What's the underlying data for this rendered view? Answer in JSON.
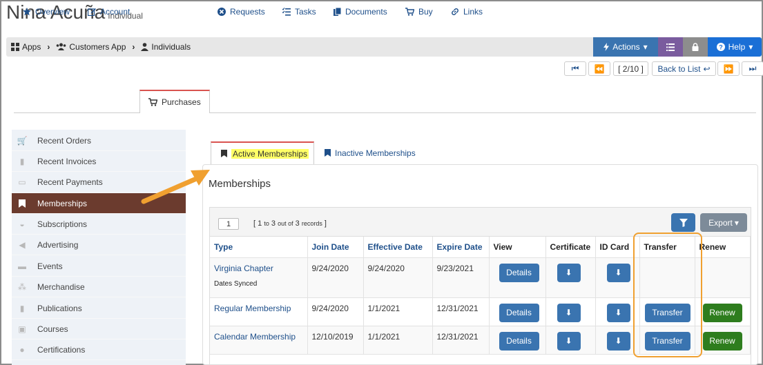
{
  "header": {
    "name": "Nina Acuña",
    "type": "Individual"
  },
  "breadcrumb": [
    {
      "label": "Apps",
      "icon": "grid-icon"
    },
    {
      "label": "Customers App",
      "icon": "users-icon"
    },
    {
      "label": "Individuals",
      "icon": "user-icon"
    }
  ],
  "toolbar": {
    "actions_label": "Actions",
    "help_label": "Help"
  },
  "pager": {
    "position": "[ 2/10 ]",
    "back_label": "Back to List"
  },
  "main_tabs": [
    {
      "label": "Overview",
      "icon": "star-icon"
    },
    {
      "label": "Account",
      "icon": "edit-icon"
    },
    {
      "label": "Purchases",
      "icon": "cart-icon",
      "active": true
    },
    {
      "label": "Requests",
      "icon": "circle-x-icon"
    },
    {
      "label": "Tasks",
      "icon": "tasks-icon"
    },
    {
      "label": "Documents",
      "icon": "documents-icon"
    },
    {
      "label": "Buy",
      "icon": "cart-icon"
    },
    {
      "label": "Links",
      "icon": "link-icon"
    }
  ],
  "sidebar": {
    "items": [
      {
        "label": "Recent Orders",
        "icon": "cart-icon"
      },
      {
        "label": "Recent Invoices",
        "icon": "clipboard-icon"
      },
      {
        "label": "Recent Payments",
        "icon": "money-icon"
      },
      {
        "label": "Memberships",
        "icon": "bookmark-icon",
        "active": true
      },
      {
        "label": "Subscriptions",
        "icon": "inbox-icon"
      },
      {
        "label": "Advertising",
        "icon": "megaphone-icon"
      },
      {
        "label": "Events",
        "icon": "ticket-icon"
      },
      {
        "label": "Merchandise",
        "icon": "cubes-icon"
      },
      {
        "label": "Publications",
        "icon": "book-icon"
      },
      {
        "label": "Courses",
        "icon": "briefcase-icon"
      },
      {
        "label": "Certifications",
        "icon": "certificate-icon"
      }
    ]
  },
  "sub_tabs": {
    "active": "Active Memberships",
    "inactive": "Inactive Memberships"
  },
  "section_title": "Memberships",
  "table": {
    "page": "1",
    "records": {
      "from": "1",
      "to_word": "to",
      "to": "3",
      "out_of_word": "out of",
      "total": "3",
      "records_word": "records"
    },
    "export_label": "Export",
    "columns": [
      "Type",
      "Join Date",
      "Effective Date",
      "Expire Date",
      "View",
      "Certificate",
      "ID Card",
      "Transfer",
      "Renew"
    ],
    "rows": [
      {
        "type": "Virginia Chapter",
        "note": "Dates Synced",
        "join": "9/24/2020",
        "effective": "9/24/2020",
        "expire": "9/23/2021",
        "view": "Details",
        "transfer": "",
        "renew": ""
      },
      {
        "type": "Regular Membership",
        "note": "",
        "join": "9/24/2020",
        "effective": "1/1/2021",
        "expire": "12/31/2021",
        "view": "Details",
        "transfer": "Transfer",
        "renew": "Renew"
      },
      {
        "type": "Calendar Membership",
        "note": "",
        "join": "12/10/2019",
        "effective": "1/1/2021",
        "expire": "12/31/2021",
        "view": "Details",
        "transfer": "Transfer",
        "renew": "Renew"
      }
    ]
  },
  "colors": {
    "primary": "#3a74b0",
    "renew": "#2e7d1e",
    "active_sidebar": "#6b3b2e",
    "highlight": "#f0a030"
  }
}
